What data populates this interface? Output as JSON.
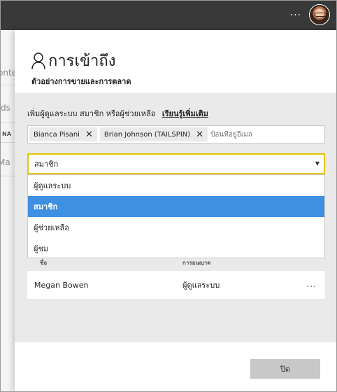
{
  "topbar": {
    "more_label": "...",
    "avatar_alt": "avatar"
  },
  "background_page": {
    "text_1": "onte",
    "text_2": "ds",
    "header_text": "NA",
    "text_3": "Ma"
  },
  "panel": {
    "title": "การเข้าถึง",
    "subtitle": "ตัวอย่างการขายและการตลาด",
    "add_instruction": "เพิ่มผู้ดูแลระบบ สมาชิก หรือผู้ช่วยเหลือ",
    "learn_more": "เรียนรู้เพิ่มเติม",
    "email_chips": [
      {
        "label": "Bianca Pisani"
      },
      {
        "label": "Brian Johnson (TAILSPIN)"
      }
    ],
    "email_placeholder": "ป้อนที่อยู่อีเมล",
    "role_select": {
      "value": "สมาชิก"
    },
    "role_options": [
      {
        "label": "ผู้ดูแลระบบ",
        "selected": false
      },
      {
        "label": "สมาชิก",
        "selected": true
      },
      {
        "label": "ผู้ช่วยเหลือ",
        "selected": false
      },
      {
        "label": "ผู้ชม",
        "selected": false
      }
    ],
    "list_headers": {
      "name": "ชื่อ",
      "permission": "การอนุญาต"
    },
    "users": [
      {
        "name": "Megan Bowen",
        "permission": "ผู้ดูแลระบบ",
        "more": "..."
      }
    ],
    "close_label": "ปิด"
  },
  "colors": {
    "accent_focus": "#e8c400",
    "selected_option": "#3f8fe2",
    "topbar": "#393939"
  }
}
